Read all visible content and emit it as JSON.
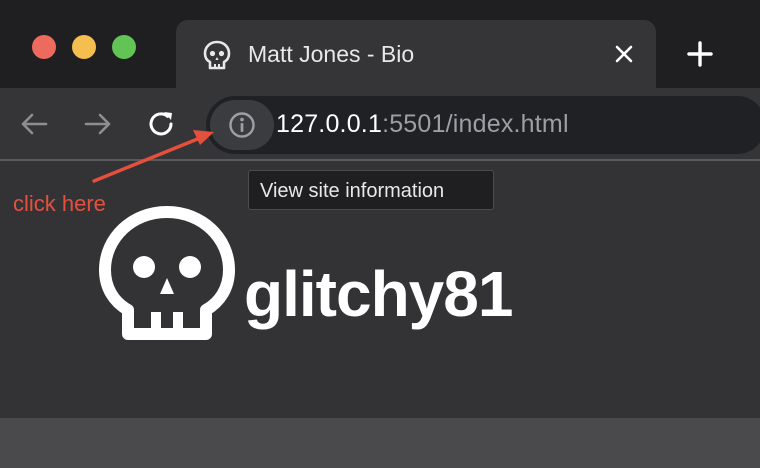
{
  "window": {
    "traffic_lights": {
      "close": "#ed6a5e",
      "minimize": "#f5bf4f",
      "zoom": "#61c454"
    }
  },
  "tab": {
    "title": "Matt Jones - Bio",
    "favicon": "skull-icon",
    "close_icon": "close-icon"
  },
  "new_tab_icon": "plus-icon",
  "toolbar": {
    "back_icon": "arrow-left-icon",
    "forward_icon": "arrow-right-icon",
    "reload_icon": "reload-icon",
    "site_info_icon": "info-icon",
    "url_host": "127.0.0.1",
    "url_rest": ":5501/index.html"
  },
  "tooltip": {
    "text": "View site information"
  },
  "annotation": {
    "text": "click here",
    "color": "#e4503d"
  },
  "page": {
    "logo_icon": "skull-icon",
    "logo_text": "glitchy81"
  }
}
